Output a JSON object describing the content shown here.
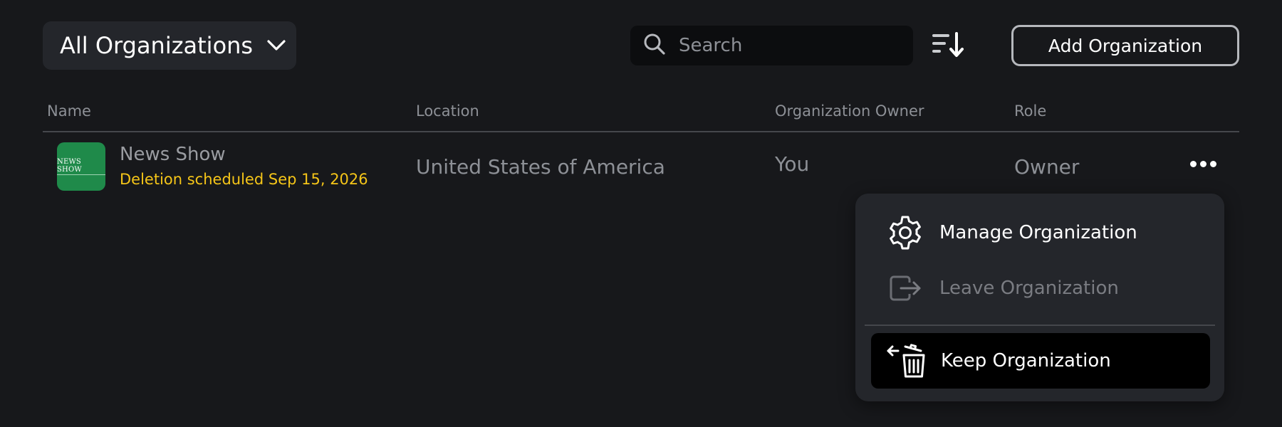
{
  "toolbar": {
    "org_filter_label": "All Organizations",
    "search_placeholder": "Search",
    "add_button_label": "Add Organization"
  },
  "table": {
    "columns": [
      "Name",
      "Location",
      "Organization Owner",
      "Role"
    ],
    "rows": [
      {
        "logo_text": "NEWS SHOW",
        "name": "News Show",
        "deletion_notice": "Deletion scheduled Sep 15, 2026",
        "location": "United States of America",
        "owner": "You",
        "role": "Owner"
      }
    ]
  },
  "menu": {
    "items": [
      {
        "label": "Manage Organization",
        "icon": "gear-icon",
        "enabled": true
      },
      {
        "label": "Leave Organization",
        "icon": "exit-icon",
        "enabled": false
      },
      {
        "label": "Keep Organization",
        "icon": "restore-trash-icon",
        "enabled": true
      }
    ]
  },
  "colors": {
    "background": "#17181b",
    "surface": "#24262b",
    "warning": "#f5c518",
    "logo_green": "#1f8a4a",
    "muted_text": "#8d9096"
  }
}
